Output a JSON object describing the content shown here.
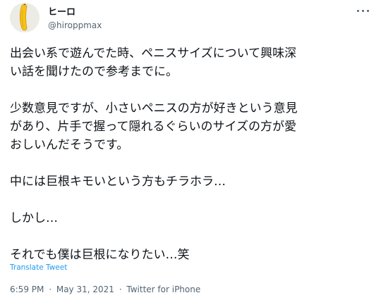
{
  "user": {
    "display_name": "ヒーロ",
    "handle": "@hiroppmax",
    "avatar_icon": "banana-icon"
  },
  "menu": {
    "more_icon": "more-icon"
  },
  "tweet": {
    "paragraphs": [
      [
        "出会い系で遊んでた時、ペニスサイズについて興味深",
        "い話を聞けたので参考までに。"
      ],
      [
        "少数意見ですが、小さいペニスの方が好きという意見",
        "があり、片手で握って隠れるぐらいのサイズの方が愛",
        "おしいんだそうです。"
      ],
      [
        "中には巨根キモいという方もチラホラ…"
      ],
      [
        "しかし…"
      ],
      [
        "それでも僕は巨根になりたい…笑"
      ]
    ],
    "translate_label": "Translate Tweet",
    "time": "6:59 PM",
    "date": "May 31, 2021",
    "source": "Twitter for iPhone",
    "separator": "·"
  },
  "colors": {
    "text": "#0f1419",
    "secondary": "#536471",
    "link": "#1d9bf0",
    "banana": "#f6c21a"
  }
}
